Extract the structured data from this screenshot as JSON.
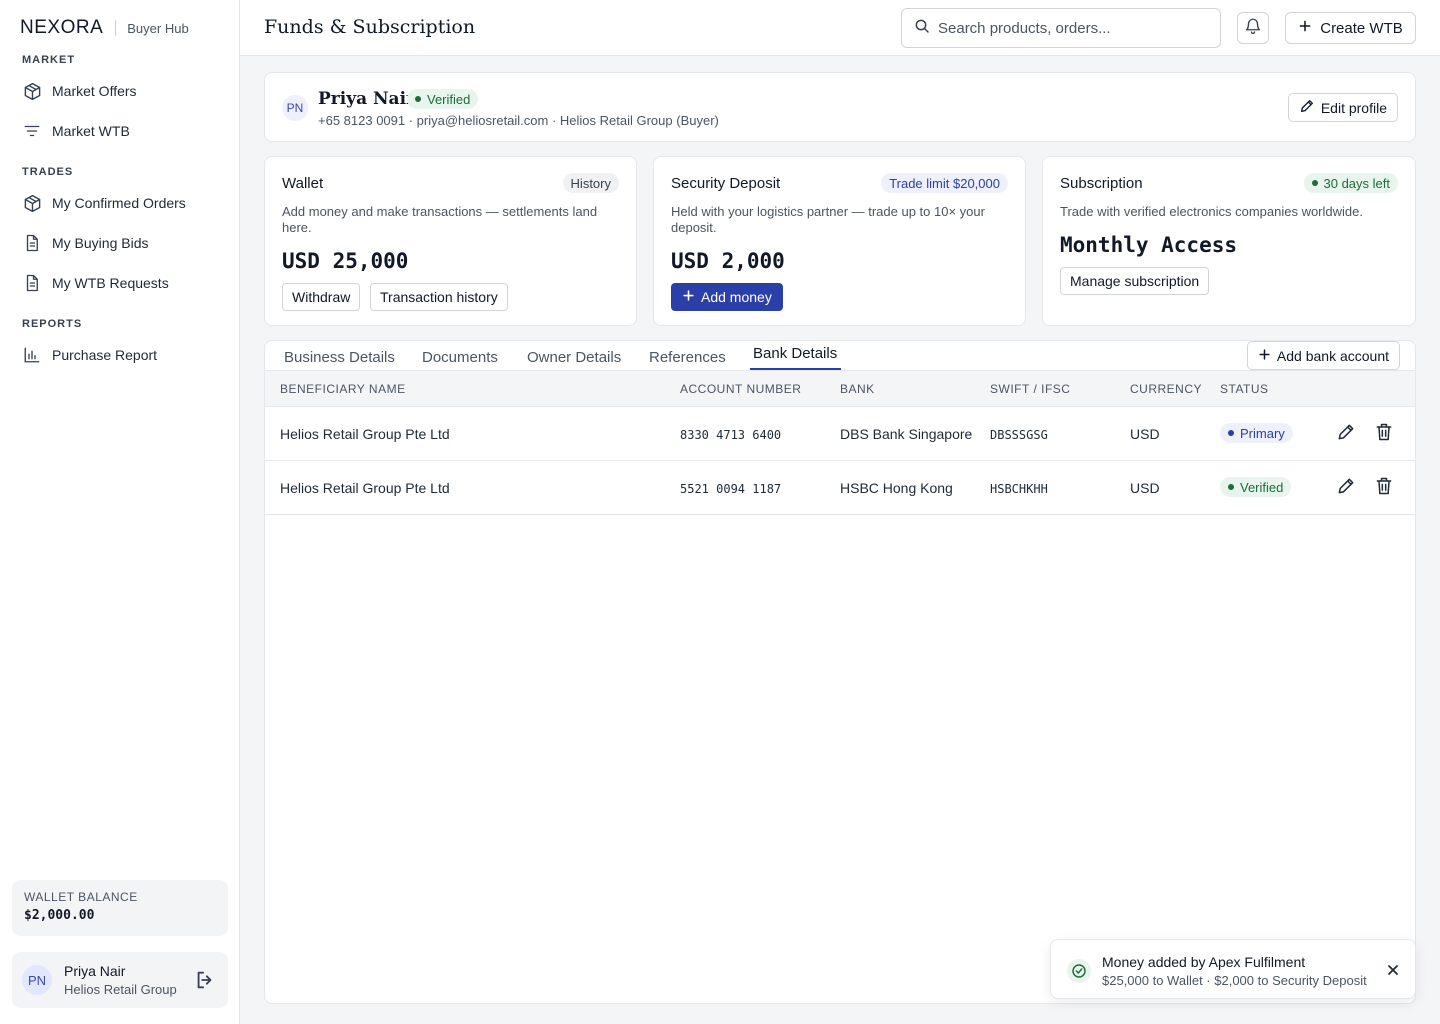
{
  "brand": {
    "logo": "NEXORA",
    "subtitle": "Buyer Hub"
  },
  "sidebar": {
    "sections": [
      {
        "label": "MARKET"
      },
      {
        "label": "TRADES"
      },
      {
        "label": "REPORTS"
      }
    ],
    "items": [
      {
        "label": "Market Offers",
        "icon": "cube-icon"
      },
      {
        "label": "Market WTB",
        "icon": "filter-icon"
      },
      {
        "label": "My Confirmed Orders",
        "icon": "cube-icon"
      },
      {
        "label": "My Buying Bids",
        "icon": "document-icon"
      },
      {
        "label": "My WTB Requests",
        "icon": "document-icon"
      },
      {
        "label": "Purchase Report",
        "icon": "bar-chart-icon"
      }
    ],
    "wallet": {
      "label": "WALLET BALANCE",
      "value": "$2,000.00"
    },
    "user": {
      "initials": "PN",
      "name": "Priya Nair",
      "company": "Helios Retail Group"
    }
  },
  "header": {
    "title": "Funds & Subscription",
    "search_placeholder": "Search products, orders...",
    "create_label": "Create WTB"
  },
  "profile": {
    "initials": "PN",
    "name": "Priya Nair",
    "status": "Verified",
    "contact": "+65 8123 0091 · priya@heliosretail.com · Helios Retail Group (Buyer)",
    "edit_label": "Edit profile"
  },
  "wallet_card": {
    "title": "Wallet",
    "badge": "History",
    "description": "Add money and make transactions — settlements land here.",
    "amount": "USD 25,000",
    "withdraw_label": "Withdraw",
    "history_label": "Transaction history"
  },
  "deposit_card": {
    "title": "Security Deposit",
    "badge": "Trade limit $20,000",
    "description": "Held with your logistics partner — trade up to 10× your deposit.",
    "amount": "USD 2,000",
    "add_label": "Add money"
  },
  "subscription_card": {
    "title": "Subscription",
    "badge": "30 days left",
    "description": "Trade with verified electronics companies worldwide.",
    "plan": "Monthly Access",
    "manage_label": "Manage subscription"
  },
  "tabs": [
    {
      "label": "Business Details"
    },
    {
      "label": "Documents"
    },
    {
      "label": "Owner Details"
    },
    {
      "label": "References"
    },
    {
      "label": "Bank Details",
      "active": true
    }
  ],
  "add_bank_label": "Add bank account",
  "table": {
    "headers": [
      "BENEFICIARY NAME",
      "ACCOUNT NUMBER",
      "BANK",
      "SWIFT / IFSC",
      "CURRENCY",
      "STATUS"
    ],
    "rows": [
      {
        "beneficiary": "Helios Retail Group Pte Ltd",
        "account": "8330 4713 6400",
        "bank": "DBS Bank Singapore",
        "swift": "DBSSSGSG",
        "currency": "USD",
        "status": "Primary"
      },
      {
        "beneficiary": "Helios Retail Group Pte Ltd",
        "account": "5521 0094 1187",
        "bank": "HSBC Hong Kong",
        "swift": "HSBCHKHH",
        "currency": "USD",
        "status": "Verified"
      }
    ]
  },
  "toast": {
    "title": "Money added by Apex Fulfilment",
    "subtitle": "$25,000 to Wallet · $2,000 to Security Deposit"
  },
  "colors": {
    "accent": "#2b3fa8",
    "success": "#1e6b3c"
  }
}
